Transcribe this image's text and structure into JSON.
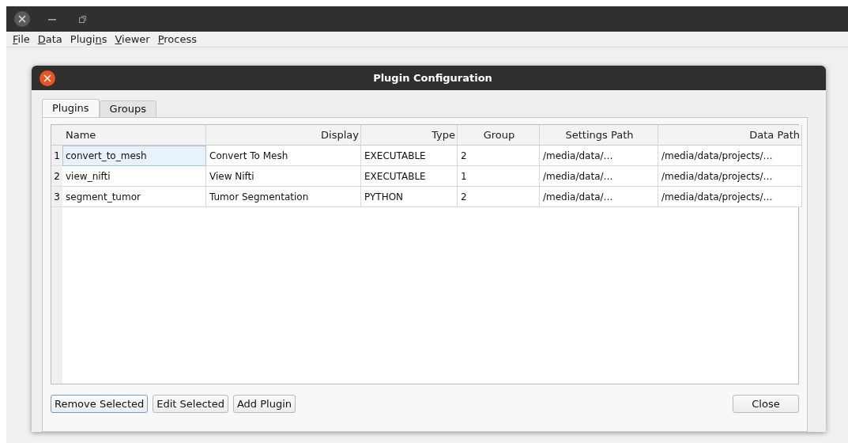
{
  "menu": [
    {
      "label": "File"
    },
    {
      "label": "Data"
    },
    {
      "label": "Plugins"
    },
    {
      "label": "Viewer"
    },
    {
      "label": "Process"
    }
  ],
  "dialog": {
    "title": "Plugin Configuration",
    "tabs": [
      {
        "label": "Plugins",
        "selected": true
      },
      {
        "label": "Groups",
        "selected": false
      }
    ],
    "table": {
      "columns": [
        {
          "label": "Name"
        },
        {
          "label": "Display"
        },
        {
          "label": "Type"
        },
        {
          "label": "Group"
        },
        {
          "label": "Settings Path"
        },
        {
          "label": "Data Path"
        }
      ],
      "rows": [
        {
          "number": "1",
          "selected": true,
          "cells": [
            "convert_to_mesh",
            "Convert To Mesh",
            "EXECUTABLE",
            "2",
            "/media/data/…",
            "/media/data/projects/…"
          ]
        },
        {
          "number": "2",
          "selected": false,
          "cells": [
            "view_nifti",
            "View Nifti",
            "EXECUTABLE",
            "1",
            "/media/data/…",
            "/media/data/projects/…"
          ]
        },
        {
          "number": "3",
          "selected": false,
          "cells": [
            "segment_tumor",
            "Tumor Segmentation",
            "PYTHON",
            "2",
            "/media/data/…",
            "/media/data/projects/…"
          ]
        }
      ]
    },
    "buttons": [
      {
        "label": "Remove Selected",
        "focused": true
      },
      {
        "label": "Edit Selected",
        "focused": false
      },
      {
        "label": "Add Plugin",
        "focused": false
      }
    ],
    "close_button": "Close"
  }
}
